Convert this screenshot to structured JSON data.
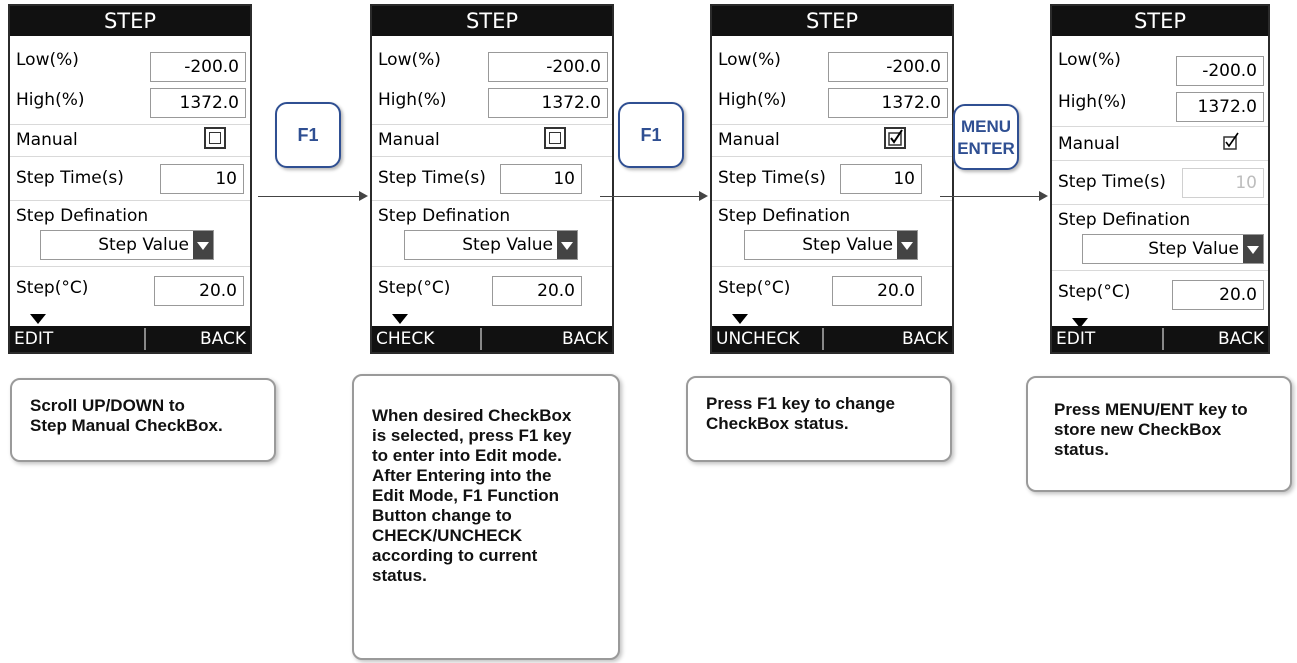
{
  "screens": [
    {
      "title": "STEP",
      "low_label": "Low(%)",
      "low_value": "-200.0",
      "high_label": "High(%)",
      "high_value": "1372.0",
      "manual_label": "Manual",
      "manual_state": "unchecked",
      "step_time_label": "Step Time(s)",
      "step_time_value": "10",
      "step_def_label": "Step Defination",
      "step_def_value": "Step Value",
      "step_label": "Step(°C)",
      "step_value": "20.0",
      "f1": "EDIT",
      "f2": "BACK"
    },
    {
      "title": "STEP",
      "low_label": "Low(%)",
      "low_value": "-200.0",
      "high_label": "High(%)",
      "high_value": "1372.0",
      "manual_label": "Manual",
      "manual_state": "unchecked",
      "step_time_label": "Step Time(s)",
      "step_time_value": "10",
      "step_def_label": "Step Defination",
      "step_def_value": "Step Value",
      "step_label": "Step(°C)",
      "step_value": "20.0",
      "f1": "CHECK",
      "f2": "BACK"
    },
    {
      "title": "STEP",
      "low_label": "Low(%)",
      "low_value": "-200.0",
      "high_label": "High(%)",
      "high_value": "1372.0",
      "manual_label": "Manual",
      "manual_state": "checked",
      "step_time_label": "Step Time(s)",
      "step_time_value": "10",
      "step_def_label": "Step Defination",
      "step_def_value": "Step Value",
      "step_label": "Step(°C)",
      "step_value": "20.0",
      "f1": "UNCHECK",
      "f2": "BACK"
    },
    {
      "title": "STEP",
      "low_label": "Low(%)",
      "low_value": "-200.0",
      "high_label": "High(%)",
      "high_value": "1372.0",
      "manual_label": "Manual",
      "manual_state": "checked",
      "step_time_label": "Step Time(s)",
      "step_time_value": "10",
      "step_def_label": "Step Defination",
      "step_def_value": "Step Value",
      "step_label": "Step(°C)",
      "step_value": "20.0",
      "f1": "EDIT",
      "f2": "BACK"
    }
  ],
  "keys": [
    {
      "line1": "F1",
      "line2": ""
    },
    {
      "line1": "F1",
      "line2": ""
    },
    {
      "line1": "MENU",
      "line2": "ENTER"
    }
  ],
  "notes": [
    [
      "Scroll UP/DOWN to",
      "Step Manual CheckBox."
    ],
    [
      "When desired CheckBox",
      "is selected, press F1 key",
      "to enter into Edit mode.",
      "After Entering into the",
      "Edit Mode, F1 Function",
      "Button change to",
      "CHECK/UNCHECK",
      "according to current",
      "status."
    ],
    [
      "Press F1 key to change",
      "CheckBox status."
    ],
    [
      "Press MENU/ENT key to",
      "store new CheckBox",
      "status."
    ]
  ],
  "colors": {
    "key_border": "#2f4f92",
    "screen_bar": "#111111"
  }
}
